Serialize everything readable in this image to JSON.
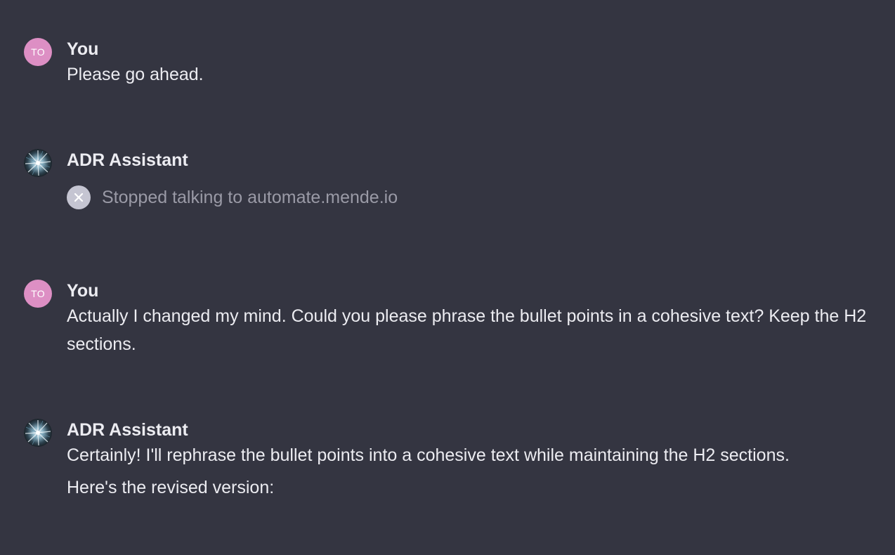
{
  "colors": {
    "background": "#343541",
    "user_avatar": "#dd8fc4",
    "text": "#ececf1",
    "muted_text": "#9a9aa6"
  },
  "messages": [
    {
      "role": "user",
      "avatar_initials": "TO",
      "author": "You",
      "paragraphs": [
        "Please go ahead."
      ]
    },
    {
      "role": "assistant",
      "author": "ADR Assistant",
      "plugin_status": {
        "icon": "close-icon",
        "text": "Stopped talking to automate.mende.io"
      }
    },
    {
      "role": "user",
      "avatar_initials": "TO",
      "author": "You",
      "paragraphs": [
        "Actually I changed my mind. Could you please phrase the bullet points in a cohesive text? Keep the H2 sections."
      ]
    },
    {
      "role": "assistant",
      "author": "ADR Assistant",
      "paragraphs": [
        "Certainly! I'll rephrase the bullet points into a cohesive text while maintaining the H2 sections.",
        "Here's the revised version:"
      ]
    }
  ]
}
